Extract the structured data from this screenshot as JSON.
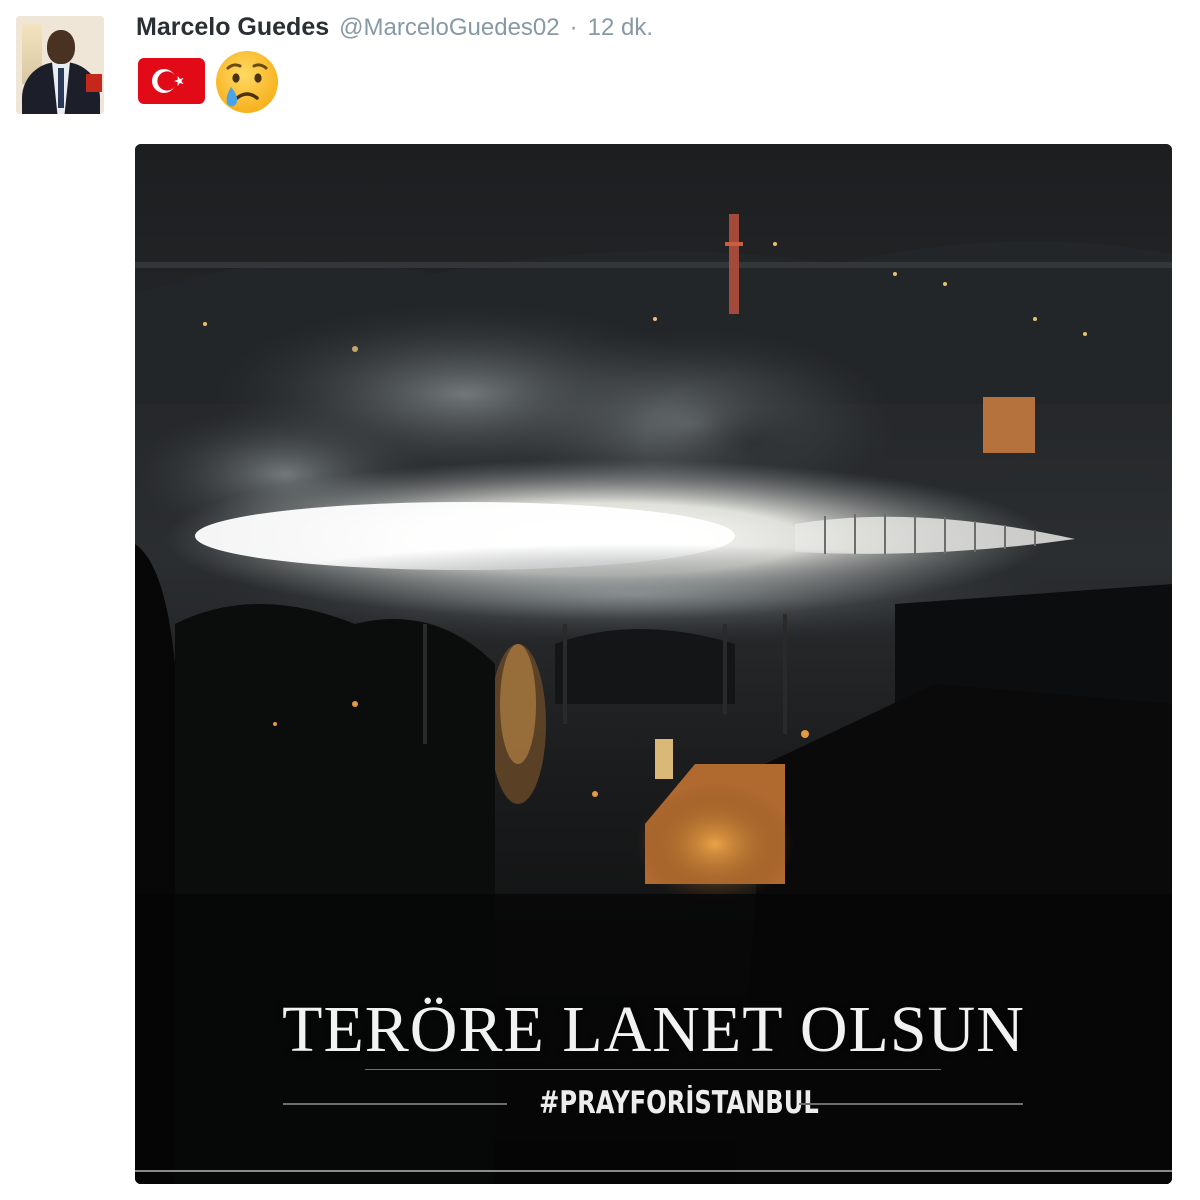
{
  "tweet": {
    "author_name": "Marcelo Guedes",
    "author_handle": "@MarceloGuedes02",
    "separator": "·",
    "time": "12 dk.",
    "emojis": [
      "turkey-flag-icon",
      "crying-face-icon"
    ],
    "image": {
      "caption_main": "TERÖRE LANET OLSUN",
      "caption_hashtag": "#PRAYFORİSTANBUL"
    }
  },
  "colors": {
    "name": "#292f33",
    "meta": "#8899a6",
    "flag_red": "#e30a17",
    "photo_bg": "#0b0b0c"
  }
}
